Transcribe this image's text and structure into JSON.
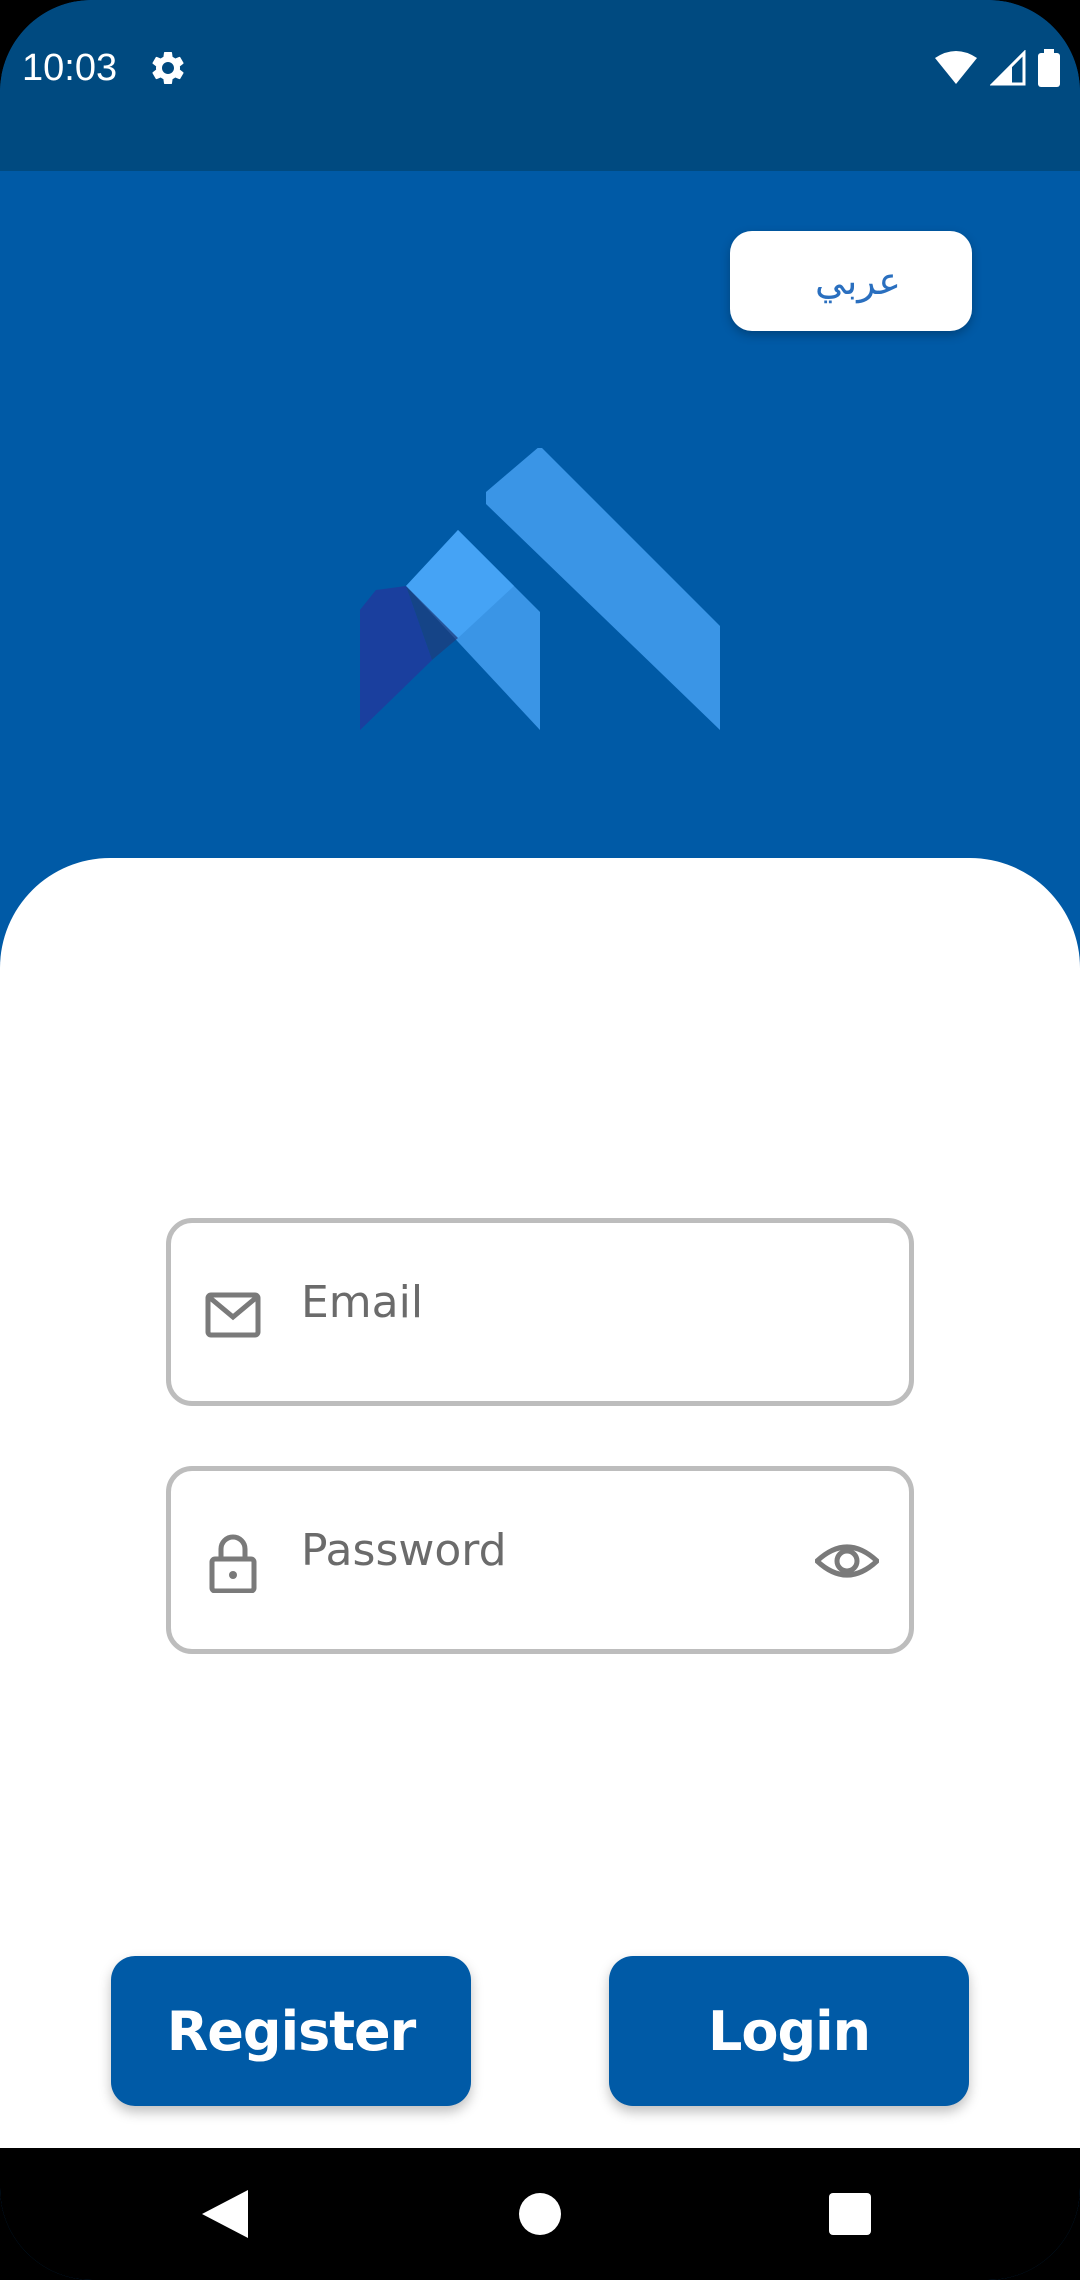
{
  "status_bar": {
    "time": "10:03",
    "icons": [
      "settings-icon",
      "wifi-icon",
      "signal-icon",
      "battery-icon"
    ]
  },
  "language_button": {
    "label": "عربي"
  },
  "form": {
    "email": {
      "placeholder": "Email",
      "icon": "mail-icon"
    },
    "password": {
      "placeholder": "Password",
      "icon": "lock-icon",
      "toggle_icon": "eye-icon"
    }
  },
  "actions": {
    "register_label": "Register",
    "login_label": "Login"
  },
  "navigation": {
    "icons": [
      "back-icon",
      "home-icon",
      "recents-icon"
    ]
  },
  "colors": {
    "primary": "#005aa6",
    "status_bar": "#004a80",
    "field_border": "#bdbdbd",
    "placeholder_text": "#6b6b6b",
    "language_text": "#2a6fbf"
  }
}
